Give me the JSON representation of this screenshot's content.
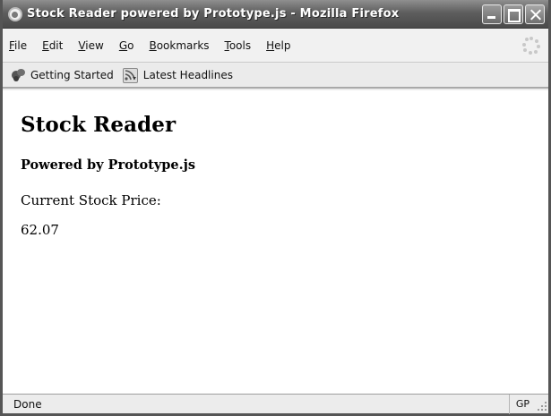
{
  "window": {
    "title": "Stock Reader powered by Prototype.js - Mozilla Firefox",
    "icon": "firefox-app-icon"
  },
  "menubar": {
    "items": [
      {
        "label": "File",
        "key": "F",
        "rest": "ile"
      },
      {
        "label": "Edit",
        "key": "E",
        "rest": "dit"
      },
      {
        "label": "View",
        "key": "V",
        "rest": "iew"
      },
      {
        "label": "Go",
        "key": "G",
        "rest": "o"
      },
      {
        "label": "Bookmarks",
        "key": "B",
        "rest": "ookmarks"
      },
      {
        "label": "Tools",
        "key": "T",
        "rest": "ools"
      },
      {
        "label": "Help",
        "key": "H",
        "rest": "elp"
      }
    ]
  },
  "bookmarks": {
    "items": [
      {
        "label": "Getting Started",
        "icon": "getting-started-icon"
      },
      {
        "label": "Latest Headlines",
        "icon": "rss-feed-icon"
      }
    ]
  },
  "page": {
    "heading": "Stock Reader",
    "subheading": "Powered by Prototype.js",
    "price_label": "Current Stock Price:",
    "price_value": "62.07"
  },
  "statusbar": {
    "text": "Done",
    "panel": "GP"
  }
}
